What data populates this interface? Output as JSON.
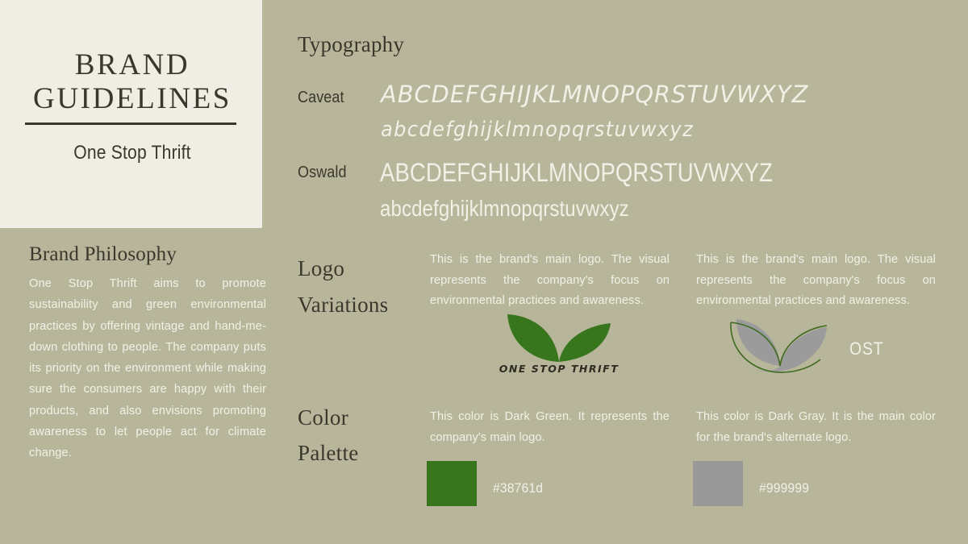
{
  "theme": {
    "background": "#b8b69a",
    "panel": "#f0ede5",
    "dark_text": "#3b372d",
    "light_text": "#f2f0e6"
  },
  "cover": {
    "title": "BRAND GUIDELINES",
    "subtitle": "One Stop Thrift"
  },
  "philosophy": {
    "heading": "Brand Philosophy",
    "body": "One Stop Thrift aims to promote sustainability and green environmental practices by offering vintage and hand-me-down clothing to people. The company puts its priority on the environment while making sure the consumers are happy with their products, and also envisions promoting awareness to let people act for climate change."
  },
  "typography": {
    "heading": "Typography",
    "fonts": [
      {
        "name": "Caveat",
        "uppercase": "ABCDEFGHIJKLMNOPQRSTUVWXYZ",
        "lowercase": "abcdefghijklmnopqrstuvwxyz"
      },
      {
        "name": "Oswald",
        "uppercase": "ABCDEFGHIJKLMNOPQRSTUVWXYZ",
        "lowercase": "abcdefghijklmnopqrstuvwxyz"
      }
    ]
  },
  "logo_variations": {
    "heading_line1": "Logo",
    "heading_line2": "Variations",
    "items": [
      {
        "description": "This is the brand's main logo. The visual represents the company's focus on environmental practices and awareness.",
        "wordmark": "ONE STOP THRIFT",
        "leaf_color": "#38761d"
      },
      {
        "description": "This is the brand's main logo. The visual represents the company's focus on environmental practices and awareness.",
        "wordmark": "OST",
        "leaf_color": "#999999",
        "outline_color": "#3e6b20"
      }
    ]
  },
  "color_palette": {
    "heading_line1": "Color",
    "heading_line2": "Palette",
    "swatches": [
      {
        "description": "This color is Dark Green. It represents the company's main logo.",
        "hex": "#38761d"
      },
      {
        "description": "This color is Dark Gray. It is the main color for the brand's alternate logo.",
        "hex": "#999999"
      }
    ]
  }
}
